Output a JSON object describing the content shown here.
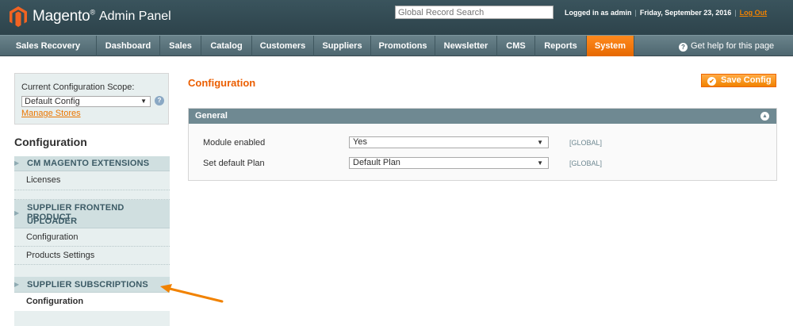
{
  "header": {
    "logo_text": "Magento",
    "logo_reg": "®",
    "logo_sub": "Admin Panel",
    "search_placeholder": "Global Record Search",
    "logged_in": "Logged in as admin",
    "date": "Friday, September 23, 2016",
    "logout": "Log Out",
    "separator": "|"
  },
  "nav": {
    "items": [
      "Sales Recovery",
      "Dashboard",
      "Sales",
      "Catalog",
      "Customers",
      "Suppliers",
      "Promotions",
      "Newsletter",
      "CMS",
      "Reports",
      "System"
    ],
    "active": "System",
    "help": "Get help for this page",
    "help_icon": "?"
  },
  "sidebar": {
    "scope_label": "Current Configuration Scope:",
    "scope_value": "Default Config",
    "scope_help_icon": "?",
    "manage_stores": "Manage Stores",
    "title": "Configuration",
    "sections": [
      {
        "label": "CM MAGENTO EXTENSIONS",
        "items": [
          "Licenses"
        ]
      },
      {
        "label": "SUPPLIER FRONTEND PRODUCT",
        "label2": "UPLOADER",
        "items": [
          "Configuration",
          "Products Settings"
        ]
      },
      {
        "label": "SUPPLIER SUBSCRIPTIONS",
        "items": [
          "Configuration"
        ]
      }
    ]
  },
  "main": {
    "title": "Configuration",
    "save_label": "Save Config",
    "fieldset_title": "General",
    "rows": [
      {
        "label": "Module enabled",
        "value": "Yes",
        "scope": "[GLOBAL]"
      },
      {
        "label": "Set default Plan",
        "value": "Default Plan",
        "scope": "[GLOBAL]"
      }
    ]
  },
  "colors": {
    "accent": "#eb5e00",
    "header_bg": "#2d434b",
    "nav_bg": "#4d666f",
    "annotation_arrow": "#f18200"
  }
}
